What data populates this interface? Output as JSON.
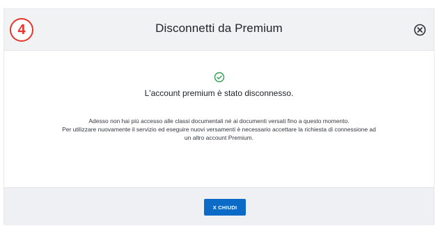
{
  "step_marker": "4",
  "dialog": {
    "title": "Disconnetti da Premium",
    "close_icon": "close-circle-icon",
    "status_icon": "check-circle-icon",
    "headline": "L'account premium è stato disconnesso.",
    "description_lines": [
      "Adesso non hai più accesso alle classi documentali né ai documenti versati fino a questo momento.",
      "Per utilizzare nuovamente il servizio ed eseguire nuovi versamenti è necessario accettare la richiesta di connessione ad",
      "un altro account Premium."
    ],
    "close_button_label": "X CHIUDI"
  },
  "colors": {
    "accent": "#0b6bc6",
    "success": "#2e9e4f",
    "marker": "#e8332a",
    "header_bg": "#f1f2f4",
    "footer_bg": "#eef0f3"
  }
}
